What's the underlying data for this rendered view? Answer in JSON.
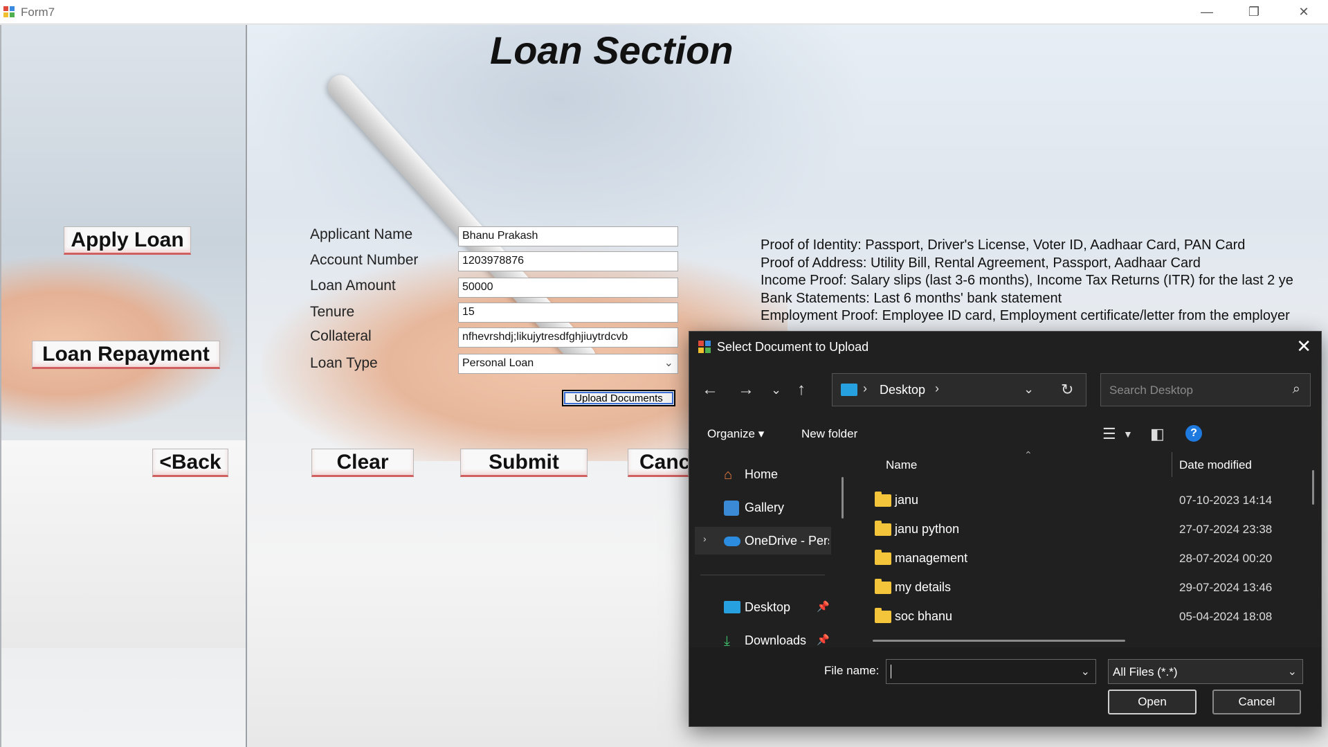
{
  "window": {
    "title": "Form7",
    "minimize": "—",
    "restore": "❐",
    "close": "✕"
  },
  "page_title": "Loan Section",
  "nav": {
    "apply_loan": "Apply Loan",
    "loan_repayment": "Loan Repayment",
    "back": "<Back"
  },
  "form": {
    "labels": {
      "applicant_name": "Applicant Name",
      "account_number": "Account Number",
      "loan_amount": "Loan Amount",
      "tenure": "Tenure",
      "collateral": "Collateral",
      "loan_type": "Loan Type"
    },
    "values": {
      "applicant_name": "Bhanu Prakash",
      "account_number": "1203978876",
      "loan_amount": "50000",
      "tenure": "15",
      "collateral": "nfhevrshdj;likujytresdfghjiuytrdcvb",
      "loan_type": "Personal Loan"
    },
    "upload_button": "Upload Documents",
    "clear_button": "Clear",
    "submit_button": "Submit",
    "cancel_button": "Canc"
  },
  "documents_info": [
    "Proof of Identity: Passport, Driver's License, Voter ID, Aadhaar Card, PAN Card",
    "Proof of Address: Utility Bill, Rental Agreement, Passport, Aadhaar Card",
    "Income Proof: Salary slips (last 3-6 months), Income Tax Returns (ITR) for the last 2 ye",
    "Bank Statements: Last 6 months' bank statement",
    "Employment Proof: Employee ID card, Employment certificate/letter from the employer"
  ],
  "dialog": {
    "title": "Select Document to Upload",
    "close": "✕",
    "address": {
      "crumb": "Desktop"
    },
    "search_placeholder": "Search Desktop",
    "toolbar": {
      "organize": "Organize ▾",
      "new_folder": "New folder"
    },
    "nav_pane": [
      {
        "label": "Home",
        "icon": "home-icon"
      },
      {
        "label": "Gallery",
        "icon": "gallery-icon"
      },
      {
        "label": "OneDrive - Pers",
        "icon": "onedrive-icon"
      },
      {
        "label": "Desktop",
        "icon": "desktop-icon"
      },
      {
        "label": "Downloads",
        "icon": "downloads-icon"
      }
    ],
    "columns": {
      "name": "Name",
      "date_modified": "Date modified"
    },
    "rows": [
      {
        "name": "janu",
        "date": "07-10-2023 14:14"
      },
      {
        "name": "janu python",
        "date": "27-07-2024 23:38"
      },
      {
        "name": "management",
        "date": "28-07-2024 00:20"
      },
      {
        "name": "my details",
        "date": "29-07-2024 13:46"
      },
      {
        "name": "soc bhanu",
        "date": "05-04-2024 18:08"
      }
    ],
    "file_name_label": "File name:",
    "file_name_value": "",
    "file_type": "All Files (*.*)",
    "open_button": "Open",
    "cancel_button": "Cancel"
  },
  "colors": {
    "dialog_bg": "#202020",
    "folder": "#f4c43a",
    "help_blue": "#1f7ae0",
    "button_accent": "#d06060"
  }
}
